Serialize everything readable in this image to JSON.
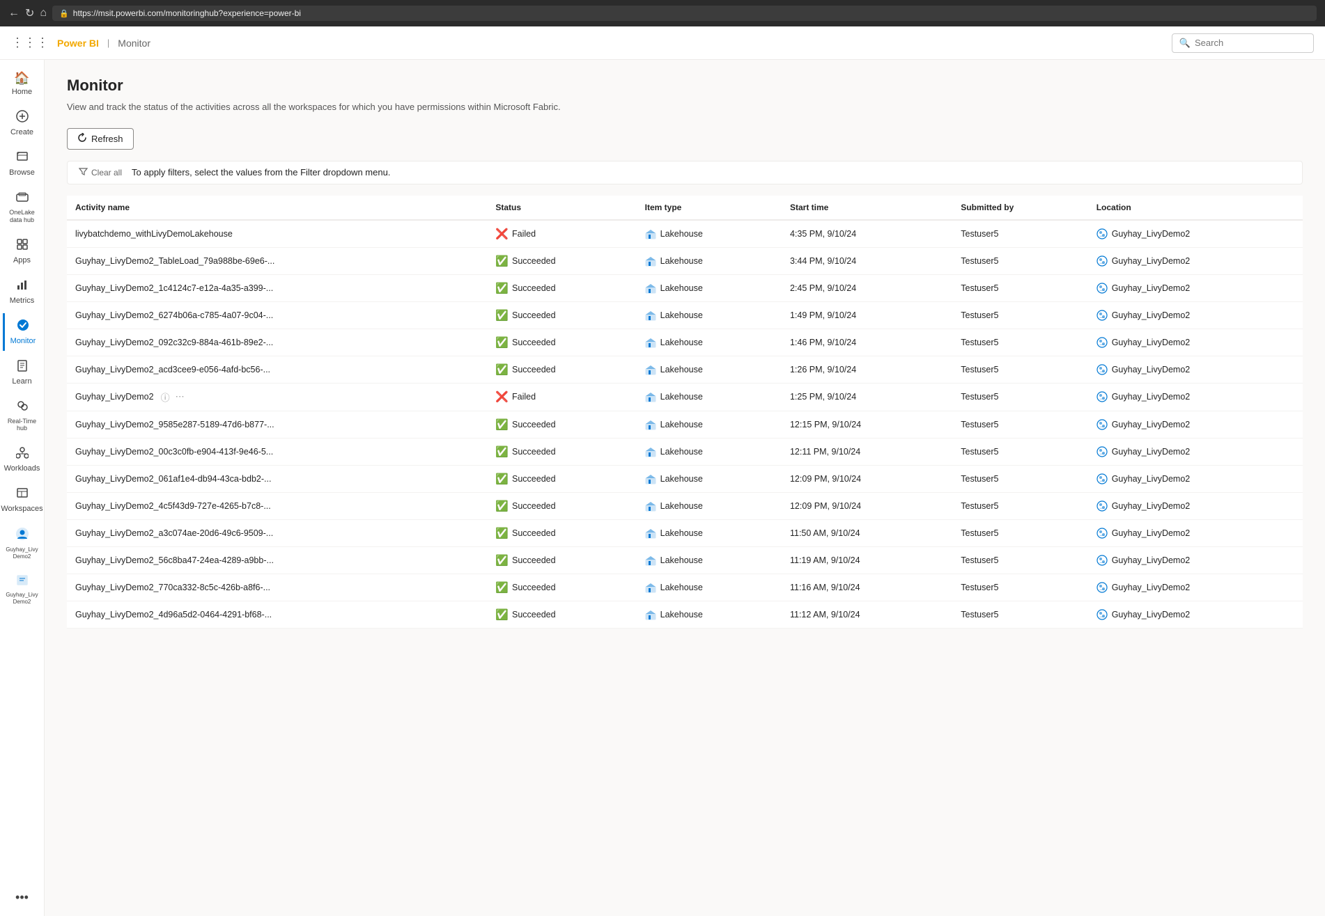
{
  "browser": {
    "url": "https://msit.powerbi.com/monitoringhub?experience=power-bi"
  },
  "topNav": {
    "brand": "Power BI",
    "breadcrumb": "Monitor",
    "search_placeholder": "Search"
  },
  "sidebar": {
    "items": [
      {
        "id": "home",
        "label": "Home",
        "icon": "🏠"
      },
      {
        "id": "create",
        "label": "Create",
        "icon": "➕"
      },
      {
        "id": "browse",
        "label": "Browse",
        "icon": "📁"
      },
      {
        "id": "onelake",
        "label": "OneLake data hub",
        "icon": "🗄"
      },
      {
        "id": "apps",
        "label": "Apps",
        "icon": "⊞"
      },
      {
        "id": "metrics",
        "label": "Metrics",
        "icon": "📊"
      },
      {
        "id": "monitor",
        "label": "Monitor",
        "icon": "🔵",
        "active": true
      },
      {
        "id": "learn",
        "label": "Learn",
        "icon": "📖"
      },
      {
        "id": "realtime",
        "label": "Real-Time hub",
        "icon": "👥"
      },
      {
        "id": "workloads",
        "label": "Workloads",
        "icon": "🔧"
      },
      {
        "id": "workspaces",
        "label": "Workspaces",
        "icon": "🗂"
      },
      {
        "id": "guyhay",
        "label": "Guyhay_Livy Demo2",
        "icon": "👤"
      },
      {
        "id": "guyhay2",
        "label": "Guyhay_Livy Demo2",
        "icon": "📄"
      },
      {
        "id": "more",
        "label": "...",
        "icon": "···"
      }
    ]
  },
  "page": {
    "title": "Monitor",
    "subtitle": "View and track the status of the activities across all the workspaces for which you have permissions within Microsoft Fabric."
  },
  "toolbar": {
    "refresh_label": "Refresh",
    "clear_all_label": "Clear all",
    "filter_hint": "To apply filters, select the values from the Filter dropdown menu."
  },
  "table": {
    "columns": [
      "Activity name",
      "Status",
      "Item type",
      "Start time",
      "Submitted by",
      "Location"
    ],
    "rows": [
      {
        "activity_name": "livybatchdemo_withLivyDemoLakehouse",
        "status": "Failed",
        "status_type": "failed",
        "item_type": "Lakehouse",
        "start_time": "4:35 PM, 9/10/24",
        "submitted_by": "Testuser5",
        "location": "Guyhay_LivyDemo2",
        "has_info": false,
        "has_more": false
      },
      {
        "activity_name": "Guyhay_LivyDemo2_TableLoad_79a988be-69e6-...",
        "status": "Succeeded",
        "status_type": "succeeded",
        "item_type": "Lakehouse",
        "start_time": "3:44 PM, 9/10/24",
        "submitted_by": "Testuser5",
        "location": "Guyhay_LivyDemo2",
        "has_info": false,
        "has_more": false
      },
      {
        "activity_name": "Guyhay_LivyDemo2_1c4124c7-e12a-4a35-a399-...",
        "status": "Succeeded",
        "status_type": "succeeded",
        "item_type": "Lakehouse",
        "start_time": "2:45 PM, 9/10/24",
        "submitted_by": "Testuser5",
        "location": "Guyhay_LivyDemo2",
        "has_info": false,
        "has_more": false
      },
      {
        "activity_name": "Guyhay_LivyDemo2_6274b06a-c785-4a07-9c04-...",
        "status": "Succeeded",
        "status_type": "succeeded",
        "item_type": "Lakehouse",
        "start_time": "1:49 PM, 9/10/24",
        "submitted_by": "Testuser5",
        "location": "Guyhay_LivyDemo2",
        "has_info": false,
        "has_more": false
      },
      {
        "activity_name": "Guyhay_LivyDemo2_092c32c9-884a-461b-89e2-...",
        "status": "Succeeded",
        "status_type": "succeeded",
        "item_type": "Lakehouse",
        "start_time": "1:46 PM, 9/10/24",
        "submitted_by": "Testuser5",
        "location": "Guyhay_LivyDemo2",
        "has_info": false,
        "has_more": false
      },
      {
        "activity_name": "Guyhay_LivyDemo2_acd3cee9-e056-4afd-bc56-...",
        "status": "Succeeded",
        "status_type": "succeeded",
        "item_type": "Lakehouse",
        "start_time": "1:26 PM, 9/10/24",
        "submitted_by": "Testuser5",
        "location": "Guyhay_LivyDemo2",
        "has_info": false,
        "has_more": false
      },
      {
        "activity_name": "Guyhay_LivyDemo2",
        "status": "Failed",
        "status_type": "failed",
        "item_type": "Lakehouse",
        "start_time": "1:25 PM, 9/10/24",
        "submitted_by": "Testuser5",
        "location": "Guyhay_LivyDemo2",
        "has_info": true,
        "has_more": true
      },
      {
        "activity_name": "Guyhay_LivyDemo2_9585e287-5189-47d6-b877-...",
        "status": "Succeeded",
        "status_type": "succeeded",
        "item_type": "Lakehouse",
        "start_time": "12:15 PM, 9/10/24",
        "submitted_by": "Testuser5",
        "location": "Guyhay_LivyDemo2",
        "has_info": false,
        "has_more": false
      },
      {
        "activity_name": "Guyhay_LivyDemo2_00c3c0fb-e904-413f-9e46-5...",
        "status": "Succeeded",
        "status_type": "succeeded",
        "item_type": "Lakehouse",
        "start_time": "12:11 PM, 9/10/24",
        "submitted_by": "Testuser5",
        "location": "Guyhay_LivyDemo2",
        "has_info": false,
        "has_more": false
      },
      {
        "activity_name": "Guyhay_LivyDemo2_061af1e4-db94-43ca-bdb2-...",
        "status": "Succeeded",
        "status_type": "succeeded",
        "item_type": "Lakehouse",
        "start_time": "12:09 PM, 9/10/24",
        "submitted_by": "Testuser5",
        "location": "Guyhay_LivyDemo2",
        "has_info": false,
        "has_more": false
      },
      {
        "activity_name": "Guyhay_LivyDemo2_4c5f43d9-727e-4265-b7c8-...",
        "status": "Succeeded",
        "status_type": "succeeded",
        "item_type": "Lakehouse",
        "start_time": "12:09 PM, 9/10/24",
        "submitted_by": "Testuser5",
        "location": "Guyhay_LivyDemo2",
        "has_info": false,
        "has_more": false
      },
      {
        "activity_name": "Guyhay_LivyDemo2_a3c074ae-20d6-49c6-9509-...",
        "status": "Succeeded",
        "status_type": "succeeded",
        "item_type": "Lakehouse",
        "start_time": "11:50 AM, 9/10/24",
        "submitted_by": "Testuser5",
        "location": "Guyhay_LivyDemo2",
        "has_info": false,
        "has_more": false
      },
      {
        "activity_name": "Guyhay_LivyDemo2_56c8ba47-24ea-4289-a9bb-...",
        "status": "Succeeded",
        "status_type": "succeeded",
        "item_type": "Lakehouse",
        "start_time": "11:19 AM, 9/10/24",
        "submitted_by": "Testuser5",
        "location": "Guyhay_LivyDemo2",
        "has_info": false,
        "has_more": false
      },
      {
        "activity_name": "Guyhay_LivyDemo2_770ca332-8c5c-426b-a8f6-...",
        "status": "Succeeded",
        "status_type": "succeeded",
        "item_type": "Lakehouse",
        "start_time": "11:16 AM, 9/10/24",
        "submitted_by": "Testuser5",
        "location": "Guyhay_LivyDemo2",
        "has_info": false,
        "has_more": false
      },
      {
        "activity_name": "Guyhay_LivyDemo2_4d96a5d2-0464-4291-bf68-...",
        "status": "Succeeded",
        "status_type": "succeeded",
        "item_type": "Lakehouse",
        "start_time": "11:12 AM, 9/10/24",
        "submitted_by": "Testuser5",
        "location": "Guyhay_LivyDemo2",
        "has_info": false,
        "has_more": false
      }
    ]
  },
  "colors": {
    "brand_yellow": "#f2a800",
    "accent_blue": "#0078d4",
    "success_green": "#107c10",
    "error_red": "#a4262c"
  }
}
